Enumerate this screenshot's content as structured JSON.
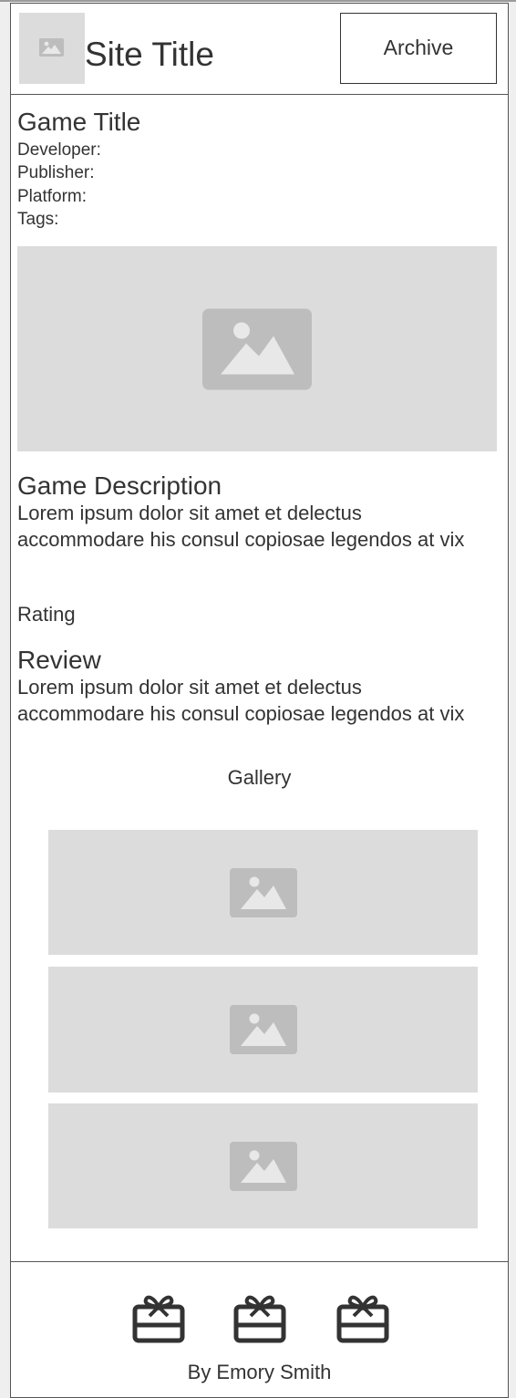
{
  "header": {
    "logo_icon": "image-icon",
    "site_title": "Site Title",
    "archive_label": "Archive"
  },
  "game": {
    "title": "Game Title",
    "developer_label": "Developer:",
    "publisher_label": "Publisher:",
    "platform_label": "Platform:",
    "tags_label": "Tags:",
    "hero_image_icon": "image-icon"
  },
  "description": {
    "heading": "Game Description",
    "text": "Lorem ipsum dolor sit amet et delectus accommodare his consul copiosae legendos at vix"
  },
  "rating": {
    "label": "Rating"
  },
  "review": {
    "heading": "Review",
    "text": "Lorem ipsum dolor sit amet et delectus accommodare his consul copiosae legendos at vix"
  },
  "gallery": {
    "label": "Gallery",
    "items": [
      {
        "icon": "image-icon"
      },
      {
        "icon": "image-icon"
      },
      {
        "icon": "image-icon"
      }
    ]
  },
  "footer": {
    "icons": [
      "gift-icon",
      "gift-icon",
      "gift-icon"
    ],
    "credit": "By Emory Smith"
  },
  "colors": {
    "placeholder_bg": "#dcdcdc",
    "placeholder_icon": "#bdbdbd",
    "text": "#333333",
    "border": "#555555"
  }
}
